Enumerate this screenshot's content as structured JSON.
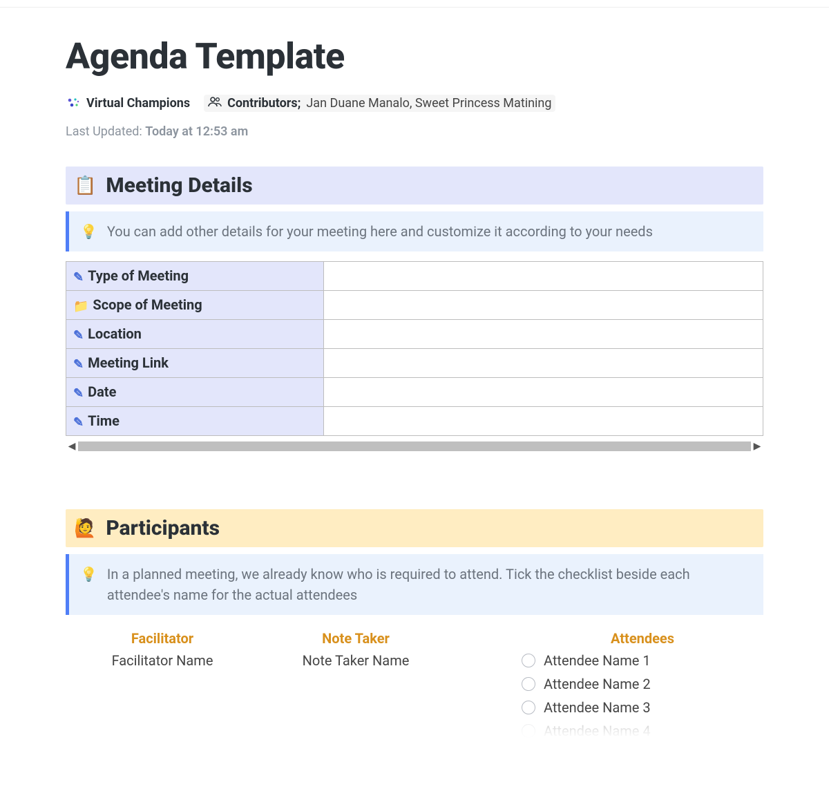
{
  "title": "Agenda Template",
  "workspace": "Virtual Champions",
  "contributors_label": "Contributors",
  "contributors": "Jan Duane Manalo, Sweet Princess Matining",
  "last_updated_label": "Last Updated:",
  "last_updated_time": "Today at 12:53 am",
  "sections": {
    "meeting_details": {
      "title": "Meeting Details",
      "emoji": "📋",
      "callout": "You can add other details for your meeting here and customize it according to your needs",
      "rows": [
        {
          "icon": "pencil",
          "label": "Type of Meeting",
          "value": ""
        },
        {
          "icon": "folder",
          "label": "Scope of Meeting",
          "value": ""
        },
        {
          "icon": "pencil",
          "label": "Location",
          "value": ""
        },
        {
          "icon": "pencil",
          "label": "Meeting Link",
          "value": ""
        },
        {
          "icon": "pencil",
          "label": "Date",
          "value": ""
        },
        {
          "icon": "pencil",
          "label": "Time",
          "value": ""
        }
      ]
    },
    "participants": {
      "title": "Participants",
      "emoji": "🙋",
      "callout": "In a planned meeting, we already know who is required to attend. Tick the checklist beside each attendee's name for the actual attendees",
      "facilitator_head": "Facilitator",
      "facilitator_name": "Facilitator Name",
      "notetaker_head": "Note Taker",
      "notetaker_name": "Note Taker Name",
      "attendees_head": "Attendees",
      "attendees": [
        "Attendee Name 1",
        "Attendee Name 2",
        "Attendee Name 3",
        "Attendee Name 4"
      ]
    }
  }
}
